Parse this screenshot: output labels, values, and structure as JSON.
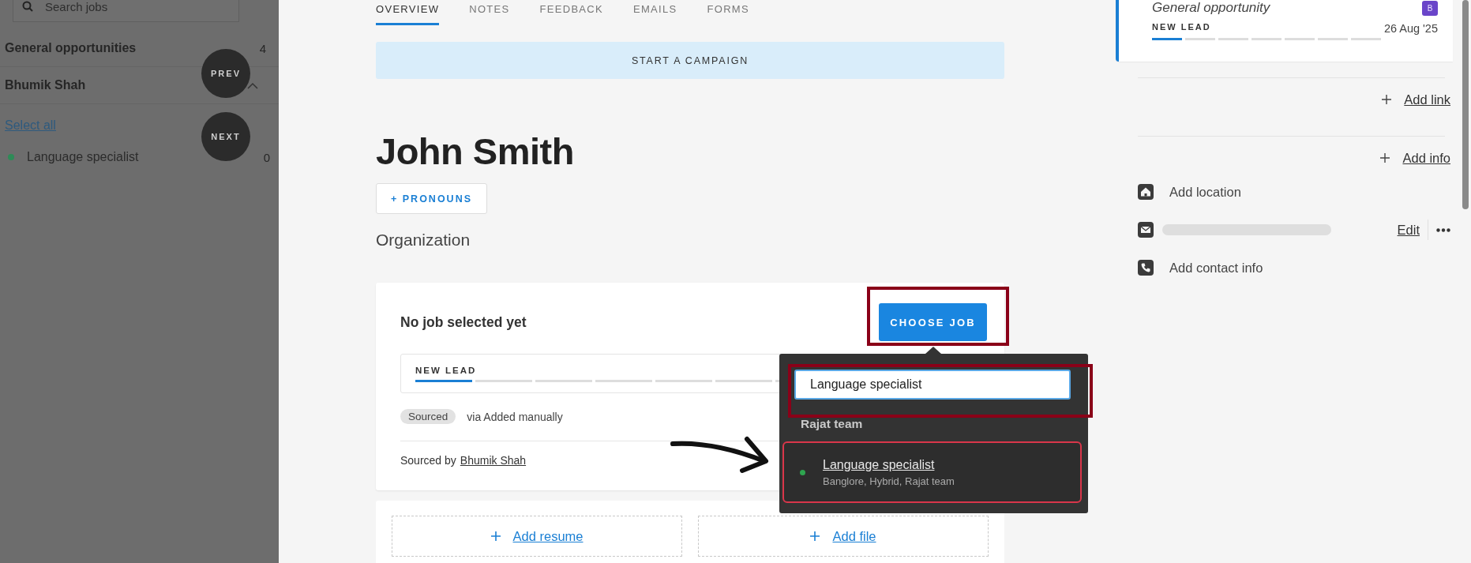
{
  "sidebar": {
    "search": {
      "placeholder": "Search jobs"
    },
    "groups": [
      {
        "title": "General opportunities",
        "count": "4"
      },
      {
        "title": "Bhumik Shah",
        "expanded": true
      }
    ],
    "select_all": "Select all",
    "jobs": [
      {
        "name": "Language specialist",
        "color": "#2e8b57",
        "count": "0"
      }
    ]
  },
  "nav_buttons": [
    "PREV",
    "NEXT"
  ],
  "tabs": [
    {
      "label": "OVERVIEW",
      "selected": true
    },
    {
      "label": "NOTES",
      "selected": false
    },
    {
      "label": "FEEDBACK",
      "selected": false
    },
    {
      "label": "EMAILS",
      "selected": false
    },
    {
      "label": "FORMS",
      "selected": false
    }
  ],
  "campaign_button": "START A CAMPAIGN",
  "candidate": {
    "name": "John Smith",
    "pronouns_button": "+ PRONOUNS",
    "organization_label": "Organization"
  },
  "job_card": {
    "title": "No job selected yet",
    "choose_button": "CHOOSE JOB",
    "stage": {
      "label": "NEW LEAD",
      "level": 0.125
    },
    "source_tag": "Sourced",
    "source_via": "via Added manually",
    "sourced_by_label": "Sourced by",
    "sourced_by": "Bhumik Shah"
  },
  "job_picker": {
    "search_value": "Language specialist",
    "group": "Rajat team",
    "results": [
      {
        "title": "Language specialist",
        "details": "Banglore, Hybrid, Rajat team",
        "color": "#2ea44f",
        "selected": true
      }
    ]
  },
  "attachments": [
    "Add resume",
    "Add file"
  ],
  "opportunity": {
    "title": "General opportunity",
    "badge": "B",
    "stage": "NEW LEAD",
    "level": 0.143,
    "date": "26 Aug '25"
  },
  "add_link": "Add link",
  "add_info": "Add info",
  "contact_rows": [
    {
      "kind": "location",
      "text": "Add location"
    },
    {
      "kind": "email",
      "action": "Edit"
    },
    {
      "kind": "phone",
      "text": "Add contact info"
    }
  ]
}
